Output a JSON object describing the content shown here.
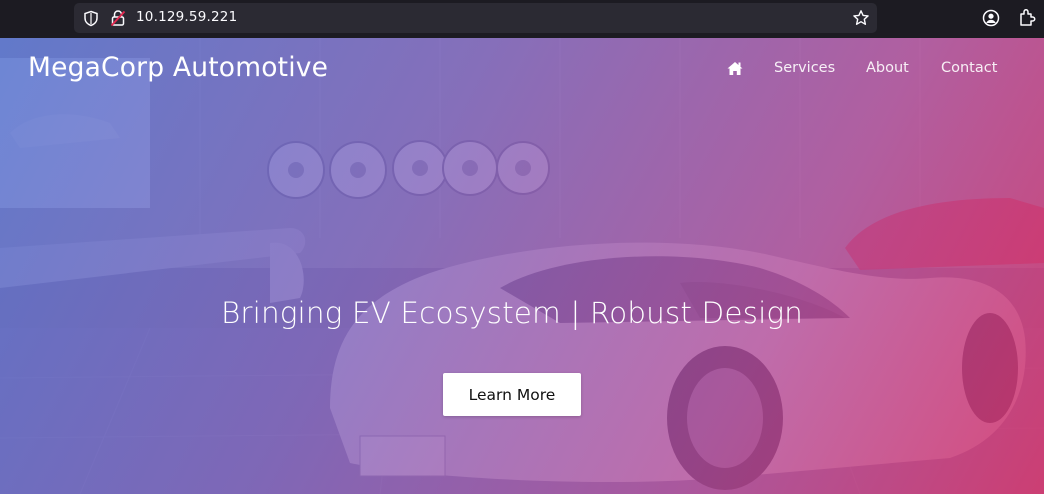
{
  "browser": {
    "url": "10.129.59.221",
    "icons": [
      "shield-icon",
      "insecure-lock-icon",
      "bookmark-star-icon",
      "account-icon",
      "extensions-icon"
    ]
  },
  "site": {
    "brand": "MegaCorp Automotive",
    "nav": {
      "home_icon": "home-icon",
      "items": [
        "Services",
        "About",
        "Contact"
      ]
    },
    "hero": {
      "headline": "Bringing EV Ecosystem | Robust Design",
      "cta_label": "Learn More"
    }
  },
  "colors": {
    "chrome_bg": "#1c1b22",
    "urlbar_bg": "#2b2a33",
    "gradient_start": "#506ecd",
    "gradient_end": "#d63269",
    "cta_bg": "#ffffff"
  }
}
